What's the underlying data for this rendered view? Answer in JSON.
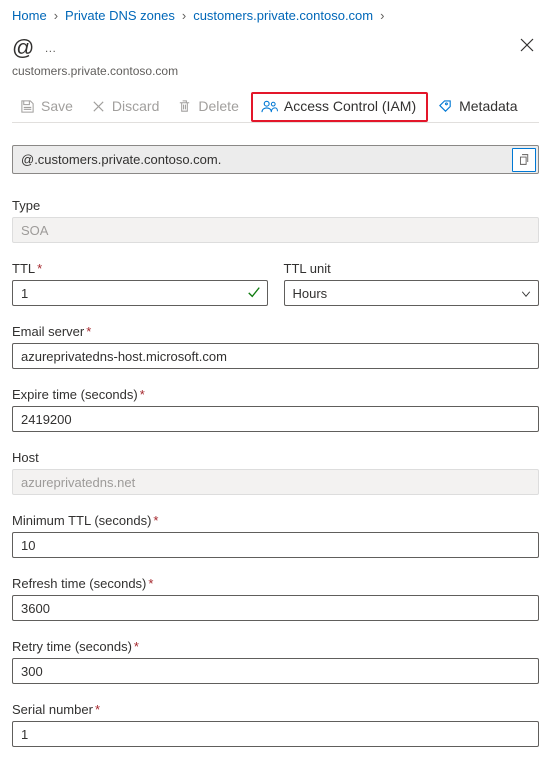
{
  "breadcrumb": {
    "home": "Home",
    "level1": "Private DNS zones",
    "level2": "customers.private.contoso.com"
  },
  "header": {
    "title": "@",
    "subtitle": "customers.private.contoso.com"
  },
  "toolbar": {
    "save": "Save",
    "discard": "Discard",
    "delete": "Delete",
    "access": "Access Control (IAM)",
    "metadata": "Metadata"
  },
  "fqdn": {
    "value": "@.customers.private.contoso.com."
  },
  "form": {
    "type_label": "Type",
    "type_value": "SOA",
    "ttl_label": "TTL",
    "ttl_value": "1",
    "ttl_unit_label": "TTL unit",
    "ttl_unit_value": "Hours",
    "email_label": "Email server",
    "email_value": "azureprivatedns-host.microsoft.com",
    "expire_label": "Expire time (seconds)",
    "expire_value": "2419200",
    "host_label": "Host",
    "host_value": "azureprivatedns.net",
    "min_ttl_label": "Minimum TTL (seconds)",
    "min_ttl_value": "10",
    "refresh_label": "Refresh time (seconds)",
    "refresh_value": "3600",
    "retry_label": "Retry time (seconds)",
    "retry_value": "300",
    "serial_label": "Serial number",
    "serial_value": "1"
  }
}
